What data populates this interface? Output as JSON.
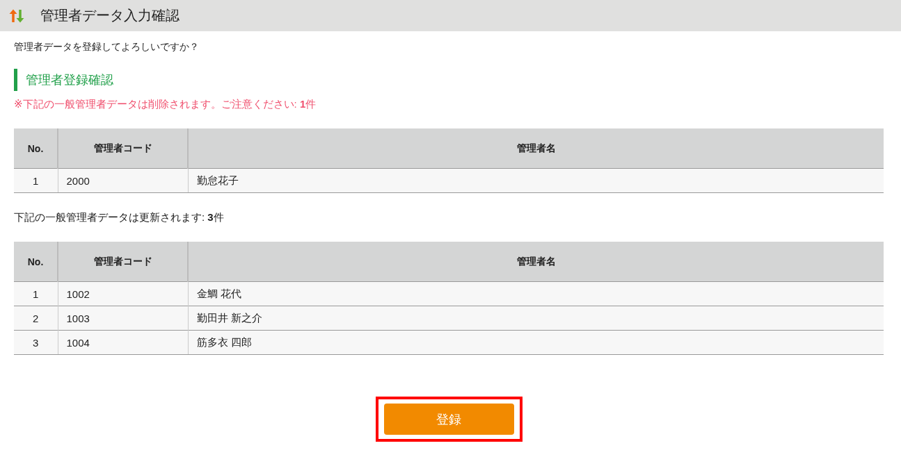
{
  "window": {
    "title": "管理者データ入力確認"
  },
  "prompt": "管理者データを登録してよろしいですか？",
  "section_title": "管理者登録確認",
  "delete_notice": "※下記の一般管理者データは削除されます。ご注意ください: **1**件",
  "delete_table": {
    "columns": [
      "No.",
      "管理者コード",
      "管理者名"
    ],
    "rows": [
      [
        "1",
        "2000",
        "勤怠花子"
      ]
    ]
  },
  "update_notice": "下記の一般管理者データは更新されます: **3**件",
  "update_table": {
    "columns": [
      "No.",
      "管理者コード",
      "管理者名"
    ],
    "rows": [
      [
        "1",
        "1002",
        "金鯛 花代"
      ],
      [
        "2",
        "1003",
        "勤田井 新之介"
      ],
      [
        "3",
        "1004",
        "筋多衣 四郎"
      ]
    ]
  },
  "register_button": {
    "label": "登録",
    "highlighted": true
  }
}
